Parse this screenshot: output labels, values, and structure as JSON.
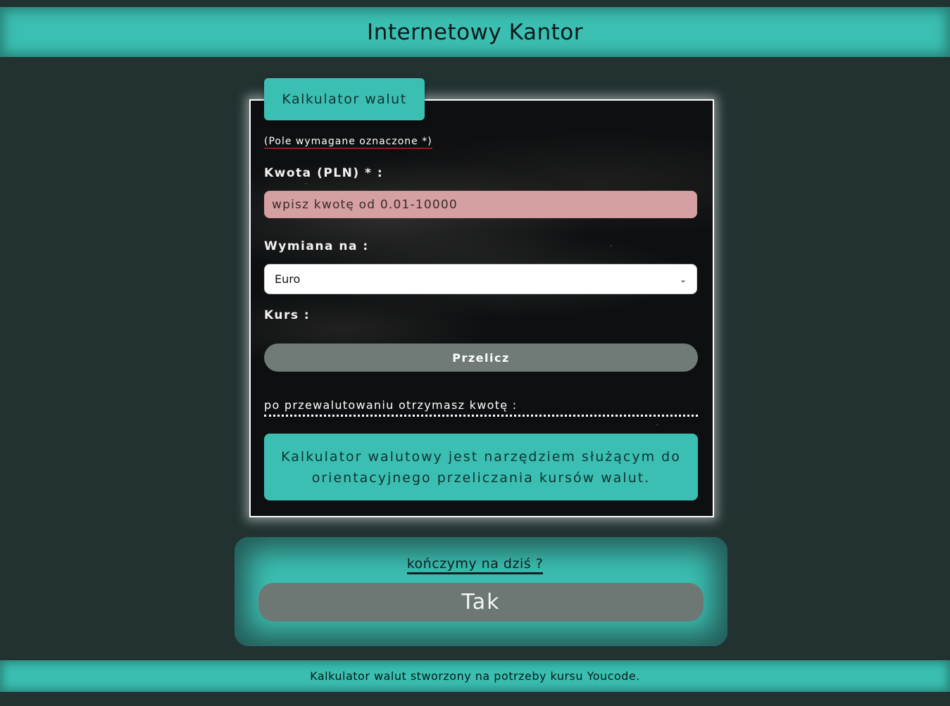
{
  "header": {
    "title": "Internetowy Kantor"
  },
  "calculator": {
    "legend": "Kalkulator walut",
    "required_note": "(Pole wymagane oznaczone *)",
    "amount_label": "Kwota (PLN) * :",
    "amount_placeholder": "wpisz kwotę od 0.01-10000",
    "currency_label": "Wymiana na :",
    "currency_selected": "Euro",
    "rate_label": "Kurs :",
    "recalc_button": "Przelicz",
    "result_label": "po przewalutowaniu otrzymasz kwotę :",
    "info_text": "Kalkulator walutowy jest narzędziem służącym do orientacyjnego przeliczania kursów walut."
  },
  "exit": {
    "question": "kończymy na dziś ?",
    "yes_button": "Tak"
  },
  "footer": {
    "text": "Kalkulator walut stworzony na potrzeby kursu Youcode."
  },
  "colors": {
    "background": "#213231",
    "accent": "#3bbfb2",
    "button": "#707b78",
    "input_invalid": "#d4a0a1"
  }
}
